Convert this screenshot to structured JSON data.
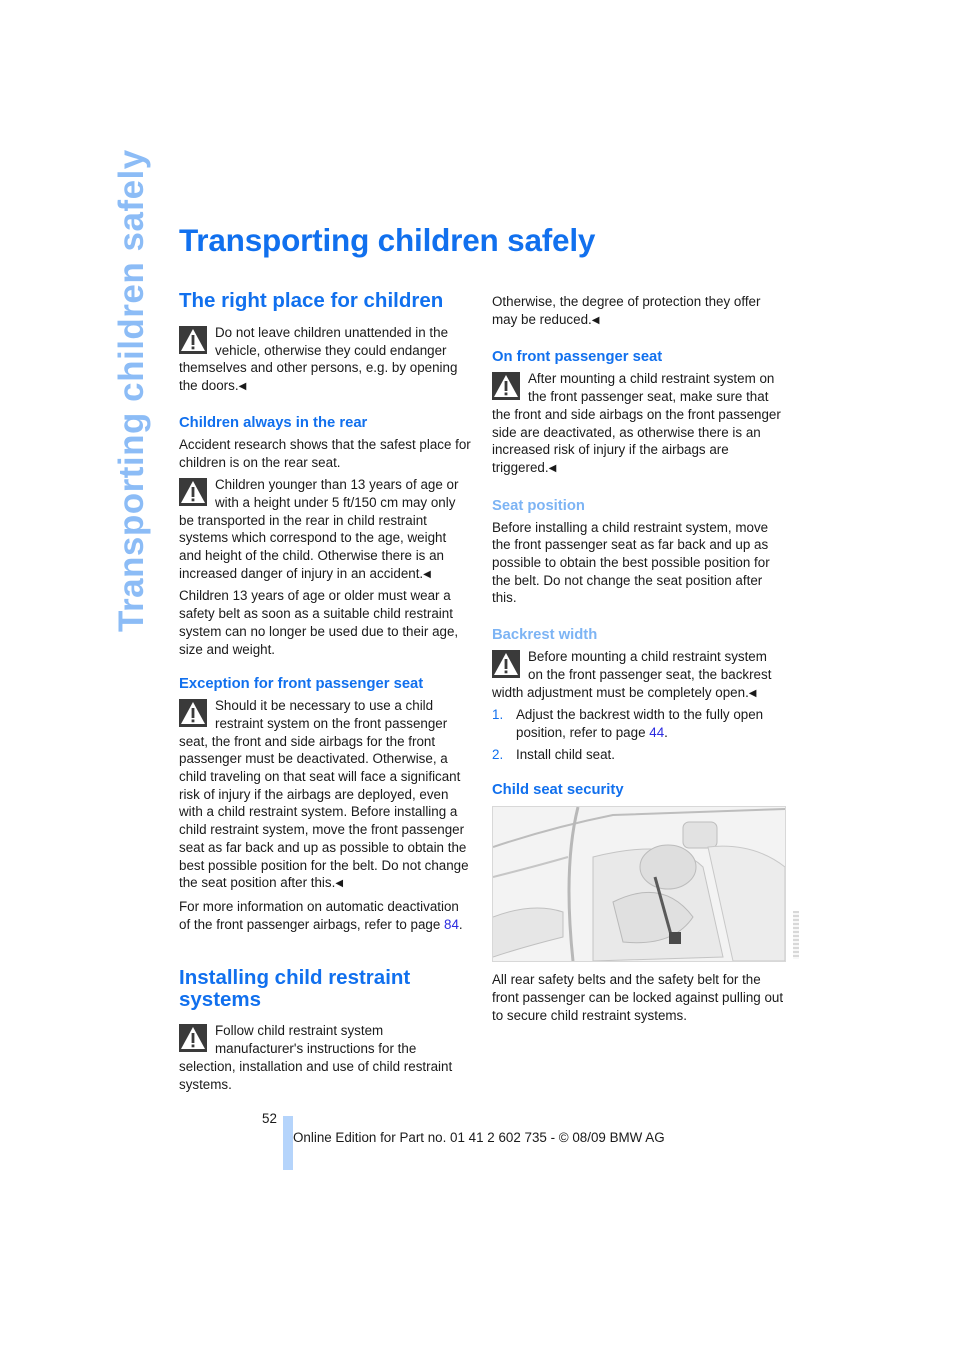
{
  "side_tab": "Transporting children safely",
  "page_title": "Transporting children safely",
  "left_column": {
    "section1_heading": "The right place for children",
    "warning1": "Do not leave children unattended in the vehicle, otherwise they could endanger themselves and other persons, e.g. by opening the doors.",
    "sub1_heading": "Children always in the rear",
    "sub1_para": "Accident research shows that the safest place for children is on the rear seat.",
    "warning2": "Children younger than 13 years of age or with a height under 5 ft/150 cm may only be transported in the rear in child restraint systems which correspond to the age, weight and height of the child. Otherwise there is an increased danger of injury in an accident.",
    "sub1_para2": "Children 13 years of age or older must wear a safety belt as soon as a suitable child restraint system can no longer be used due to their age, size and weight.",
    "sub2_heading": "Exception for front passenger seat",
    "warning3": "Should it be necessary to use a child restraint system on the front passenger seat, the front and side airbags for the front passenger must be deactivated. Otherwise, a child traveling on that seat will face a significant risk of injury if the airbags are deployed, even with a child restraint system. Before installing a child restraint system, move the front passenger seat as far back and up as possible to obtain the best possible position for the belt. Do not change the seat position after this.",
    "sub2_para_prefix": "For more information on automatic deactivation of the front passenger airbags, refer to page ",
    "sub2_para_link": "84",
    "sub2_para_suffix": ".",
    "section2_heading": "Installing child restraint systems",
    "warning4": "Follow child restraint system manufacturer's instructions for the selection, installation and use of child restraint systems."
  },
  "right_column": {
    "continuation": "Otherwise, the degree of protection they offer may be reduced.",
    "sub3_heading": "On front passenger seat",
    "warning5": "After mounting a child restraint system on the front passenger seat, make sure that the front and side airbags on the front passenger side are deactivated, as otherwise there is an increased risk of injury if the airbags are triggered.",
    "sub4_heading": "Seat position",
    "sub4_para": "Before installing a child restraint system, move the front passenger seat as far back and up as possible to obtain the best possible position for the belt. Do not change the seat position after this.",
    "sub5_heading": "Backrest width",
    "warning6": "Before mounting a child restraint system on the front passenger seat, the backrest width adjustment must be completely open.",
    "steps": [
      {
        "num": "1.",
        "text_prefix": "Adjust the backrest width to the fully open position, refer to page ",
        "link": "44",
        "text_suffix": "."
      },
      {
        "num": "2.",
        "text_prefix": "Install child seat.",
        "link": "",
        "text_suffix": ""
      }
    ],
    "sub6_heading": "Child seat security",
    "illustration_alt": "Child seat secured on rear seat with safety belt",
    "sub6_para": "All rear safety belts and the safety belt for the front passenger can be locked against pulling out to secure child restraint systems."
  },
  "icons": {
    "warning": "warning-triangle-icon",
    "end_mark": "◀"
  },
  "footer": {
    "page_number": "52",
    "edition": "Online Edition for Part no. 01 41 2 602 735 - © 08/09 BMW AG"
  },
  "colors": {
    "heading": "#1170ee",
    "subheading_light": "#7db4f4",
    "side_tab": "#8cbcf6",
    "footer_bar": "#b5d4fb",
    "link": "#2b2be0"
  }
}
